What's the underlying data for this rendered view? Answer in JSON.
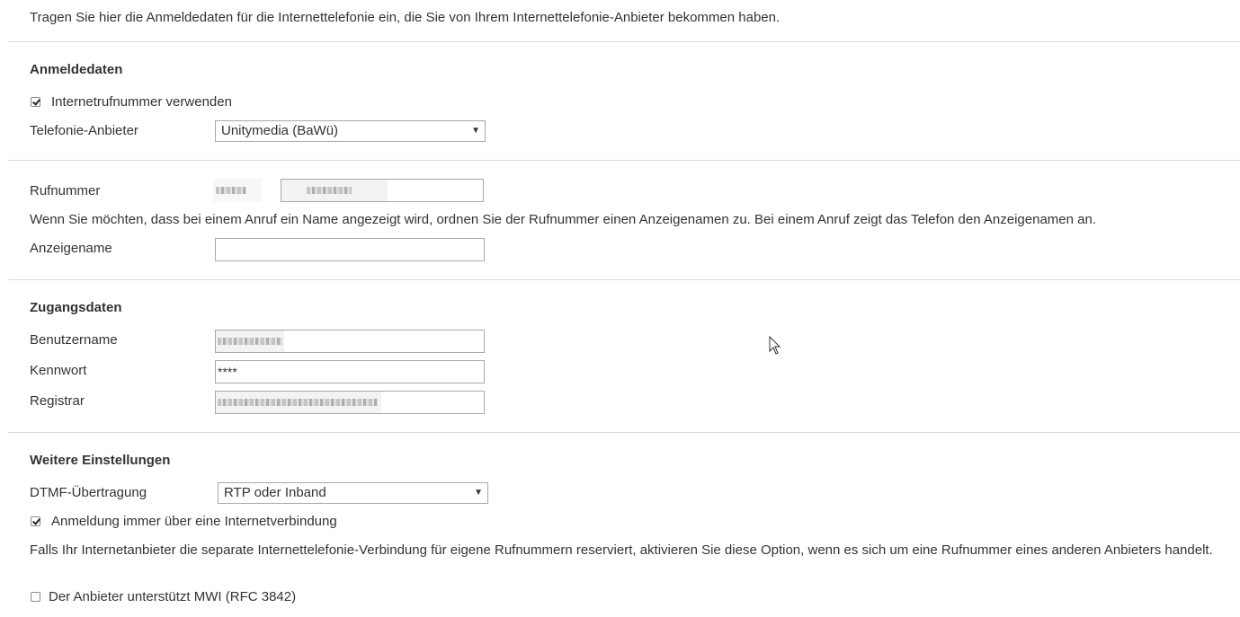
{
  "intro": "Tragen Sie hier die Anmeldedaten für die Internettelefonie ein, die Sie von Ihrem Internettelefonie-Anbieter bekommen haben.",
  "anmeldedaten": {
    "heading": "Anmeldedaten",
    "use_number_label": "Internetrufnummer verwenden",
    "use_number_checked": true,
    "provider_label": "Telefonie-Anbieter",
    "provider_value": "Unitymedia (BaWü)"
  },
  "rufnummer": {
    "label": "Rufnummer",
    "hint": "Wenn Sie möchten, dass bei einem Anruf ein Name angezeigt wird, ordnen Sie der Rufnummer einen Anzeigenamen zu. Bei einem Anruf zeigt das Telefon den Anzeigenamen an.",
    "display_name_label": "Anzeigename",
    "display_name_value": ""
  },
  "zugangsdaten": {
    "heading": "Zugangsdaten",
    "username_label": "Benutzername",
    "password_label": "Kennwort",
    "password_value": "****",
    "registrar_label": "Registrar"
  },
  "weitere": {
    "heading": "Weitere Einstellungen",
    "dtmf_label": "DTMF-Übertragung",
    "dtmf_value": "RTP oder Inband",
    "always_internet_label": "Anmeldung immer über eine Internetverbindung",
    "always_internet_checked": true,
    "always_internet_hint": "Falls Ihr Internetanbieter die separate Internettelefonie-Verbindung für eigene Rufnummern reserviert, aktivieren Sie diese Option, wenn es sich um eine Rufnummer eines anderen Anbieters handelt.",
    "mwi_label": "Der Anbieter unterstützt MWI (RFC 3842)",
    "mwi_checked": false
  },
  "icons": {
    "dropdown": "chevron-down-icon",
    "cursor": "mouse-pointer-icon"
  }
}
